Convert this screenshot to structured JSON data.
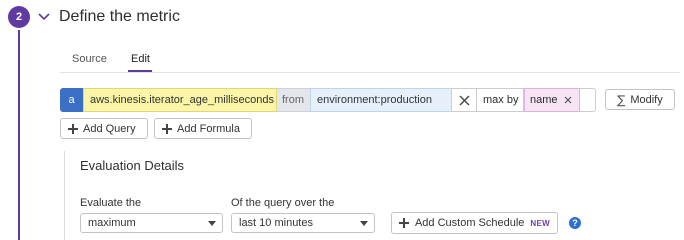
{
  "section": {
    "step_number": "2",
    "title": "Define the metric"
  },
  "tabs": [
    {
      "label": "Source"
    },
    {
      "label": "Edit"
    }
  ],
  "query": {
    "letter": "a",
    "metric": "aws.kinesis.iterator_age_milliseconds",
    "from_label": "from",
    "scope": "environment:production",
    "aggregation": "max by",
    "group_by": "name",
    "modify_label": "Modify"
  },
  "actions": {
    "add_query": "Add Query",
    "add_formula": "Add Formula"
  },
  "evaluation": {
    "title": "Evaluation Details",
    "evaluate_label": "Evaluate the",
    "evaluate_value": "maximum",
    "window_label": "Of the query over the",
    "window_value": "last 10 minutes",
    "custom_schedule_label": "Add Custom Schedule",
    "new_badge": "NEW",
    "help_glyph": "?"
  },
  "colors": {
    "accent": "#5f3aa0",
    "query_letter": "#3b6fc6",
    "metric_bg": "#fbf5a7",
    "scope_bg": "#e6f0fa",
    "groupby_bg": "#f6e4f4"
  }
}
